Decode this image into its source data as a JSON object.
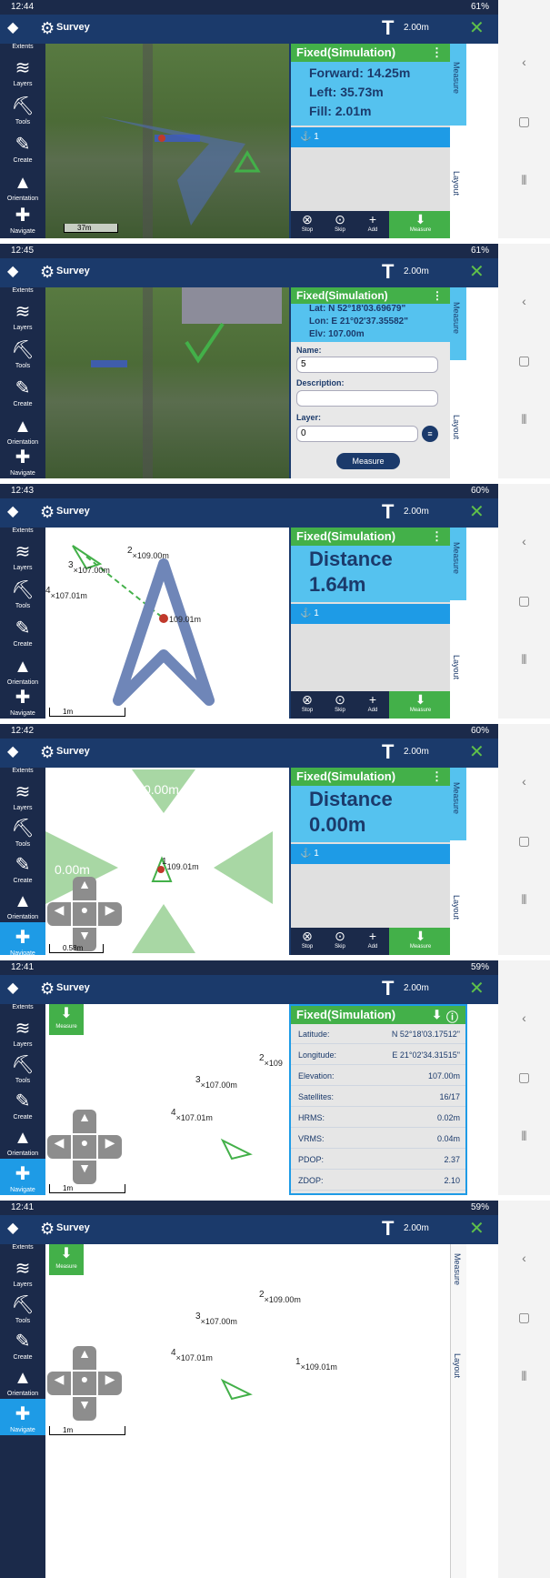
{
  "app": {
    "title": "Survey",
    "antenna_height": "2.00m"
  },
  "sidebar": {
    "items": [
      {
        "label": "Extents"
      },
      {
        "label": "Layers"
      },
      {
        "label": "Tools"
      },
      {
        "label": "Create"
      },
      {
        "label": "Orientation"
      },
      {
        "label": "Navigate"
      }
    ]
  },
  "side_tabs": {
    "measure": "Measure",
    "layout": "Layout"
  },
  "bottom_bar": {
    "stop": "Stop",
    "skip": "Skip",
    "add": "Add",
    "measure": "Measure"
  },
  "screens": [
    {
      "time": "12:44",
      "battery": "61%",
      "header": "Fixed(Simulation)",
      "lines": [
        "Forward: 14.25m",
        "Left: 35.73m",
        "Fill: 2.01m"
      ],
      "layer": "1",
      "scale": "37m"
    },
    {
      "time": "12:45",
      "battery": "61%",
      "header": "Fixed(Simulation)",
      "lines": [
        "Lat:  N 52°18'03.69679\"",
        "Lon:  E 21°02'37.35582\"",
        "Elv:  107.00m"
      ],
      "form": {
        "name_label": "Name:",
        "name_value": "5",
        "description_label": "Description:",
        "description_value": "",
        "layer_label": "Layer:",
        "layer_value": "0",
        "measure_button": "Measure"
      }
    },
    {
      "time": "12:43",
      "battery": "60%",
      "header": "Fixed(Simulation)",
      "distance_label": "Distance",
      "distance_value": "1.64m",
      "layer": "1",
      "scale": "1m",
      "points": [
        {
          "num": "2",
          "elev": "109.00m"
        },
        {
          "num": "3",
          "elev": "107.00m"
        },
        {
          "num": "4",
          "elev": "107.01m"
        },
        {
          "num": "",
          "elev": "109.01m"
        }
      ]
    },
    {
      "time": "12:42",
      "battery": "60%",
      "header": "Fixed(Simulation)",
      "distance_label": "Distance",
      "distance_value": "0.00m",
      "layer": "1",
      "scale": "0.58m",
      "offset_top": "0.00m",
      "offset_left": "0.00m",
      "point_num": "1",
      "point_elev": "109.01m"
    },
    {
      "time": "12:41",
      "battery": "59%",
      "header": "Fixed(Simulation)",
      "measure_label": "Measure",
      "scale": "1m",
      "points": [
        {
          "num": "2",
          "elev": "109"
        },
        {
          "num": "3",
          "elev": "107.00m"
        },
        {
          "num": "4",
          "elev": "107.01m"
        }
      ],
      "table": [
        {
          "k": "Latitude:",
          "v": "N 52°18'03.17512\""
        },
        {
          "k": "Longitude:",
          "v": "E 21°02'34.31515\""
        },
        {
          "k": "Elevation:",
          "v": "107.00m"
        },
        {
          "k": "Satellites:",
          "v": "16/17"
        },
        {
          "k": "HRMS:",
          "v": "0.02m"
        },
        {
          "k": "VRMS:",
          "v": "0.04m"
        },
        {
          "k": "PDOP:",
          "v": "2.37"
        },
        {
          "k": "ZDOP:",
          "v": "2.10"
        }
      ]
    },
    {
      "time": "12:41",
      "battery": "59%",
      "measure_label": "Measure",
      "scale": "1m",
      "points": [
        {
          "num": "2",
          "elev": "109.00m"
        },
        {
          "num": "3",
          "elev": "107.00m"
        },
        {
          "num": "4",
          "elev": "107.01m"
        },
        {
          "num": "1",
          "elev": "109.01m"
        }
      ]
    }
  ]
}
